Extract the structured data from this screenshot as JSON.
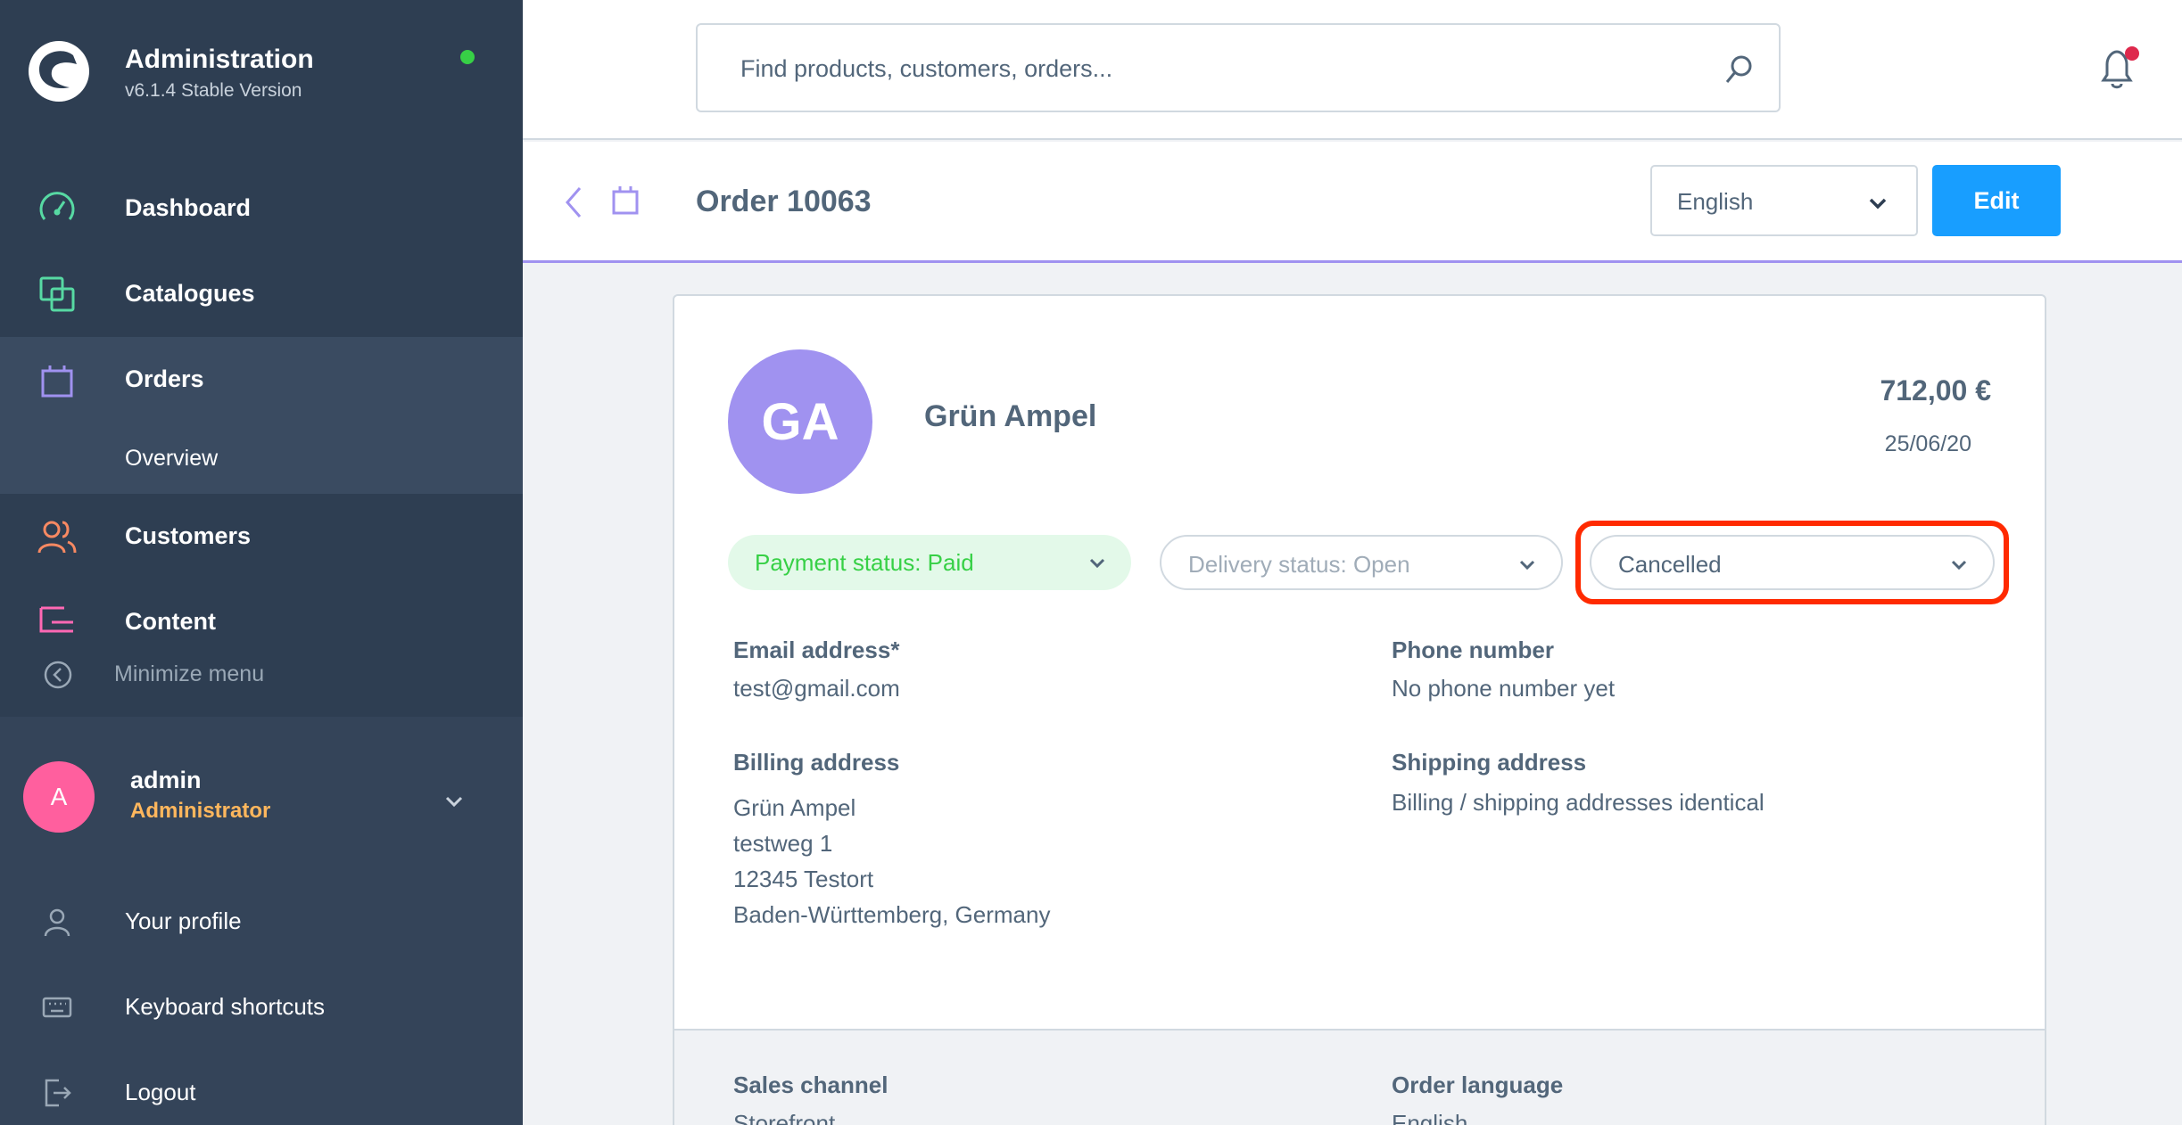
{
  "app": {
    "title": "Administration",
    "version": "v6.1.4 Stable Version"
  },
  "sidebar": {
    "items": [
      {
        "label": "Dashboard",
        "icon": "dashboard-icon",
        "color": "#57d9a3"
      },
      {
        "label": "Catalogues",
        "icon": "catalogues-icon",
        "color": "#57d9a3"
      },
      {
        "label": "Orders",
        "icon": "orders-icon",
        "color": "#a092f0"
      },
      {
        "label": "Customers",
        "icon": "customers-icon",
        "color": "#f88962"
      },
      {
        "label": "Content",
        "icon": "content-icon",
        "color": "#ff68b4"
      }
    ],
    "sub_item": "Overview",
    "minimize": "Minimize menu"
  },
  "user": {
    "initial": "A",
    "name": "admin",
    "role": "Administrator",
    "links": [
      "Your profile",
      "Keyboard shortcuts",
      "Logout"
    ]
  },
  "search": {
    "placeholder": "Find products, customers, orders..."
  },
  "header": {
    "title": "Order 10063",
    "language": "English",
    "edit_label": "Edit"
  },
  "order": {
    "initials": "GA",
    "customer_name": "Grün Ampel",
    "amount": "712,00 €",
    "date": "25/06/20",
    "payment_status": "Payment status: Paid",
    "delivery_status": "Delivery status: Open",
    "order_status": "Cancelled",
    "email_label": "Email address*",
    "email": "test@gmail.com",
    "phone_label": "Phone number",
    "phone": "No phone number yet",
    "billing_label": "Billing address",
    "billing_lines": [
      "Grün Ampel",
      "testweg 1",
      "12345 Testort",
      "Baden-Württemberg, Germany"
    ],
    "shipping_label": "Shipping address",
    "shipping": "Billing / shipping addresses identical",
    "sales_channel_label": "Sales channel",
    "sales_channel": "Storefront",
    "order_language_label": "Order language",
    "order_language": "English"
  },
  "colors": {
    "sidebar_bg": "#2e3e52",
    "accent": "#189eff",
    "highlight": "#ff2a00",
    "paid_green": "#37d046",
    "avatar_purple": "#a092f0"
  }
}
